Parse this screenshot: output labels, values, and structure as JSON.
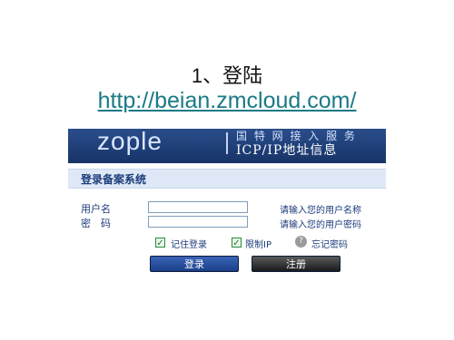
{
  "slide": {
    "title": "1、登陆",
    "link": "http://beian.zmcloud.com/"
  },
  "banner": {
    "logo": "zople",
    "top_text": "国 特 网 接 入 服 务",
    "sub_text": "ICP/IP地址信息"
  },
  "form": {
    "section_title": "登录备案系统",
    "username_label": "用户名",
    "password_label": "密　码",
    "username_hint": "请输入您的用户名称",
    "password_hint": "请输入您的用户密码",
    "remember_label": "记住登录",
    "limit_ip_label": "限制IP",
    "forgot_label": "忘记密码",
    "help_icon": "?",
    "login_button": "登录",
    "register_button": "注册"
  }
}
